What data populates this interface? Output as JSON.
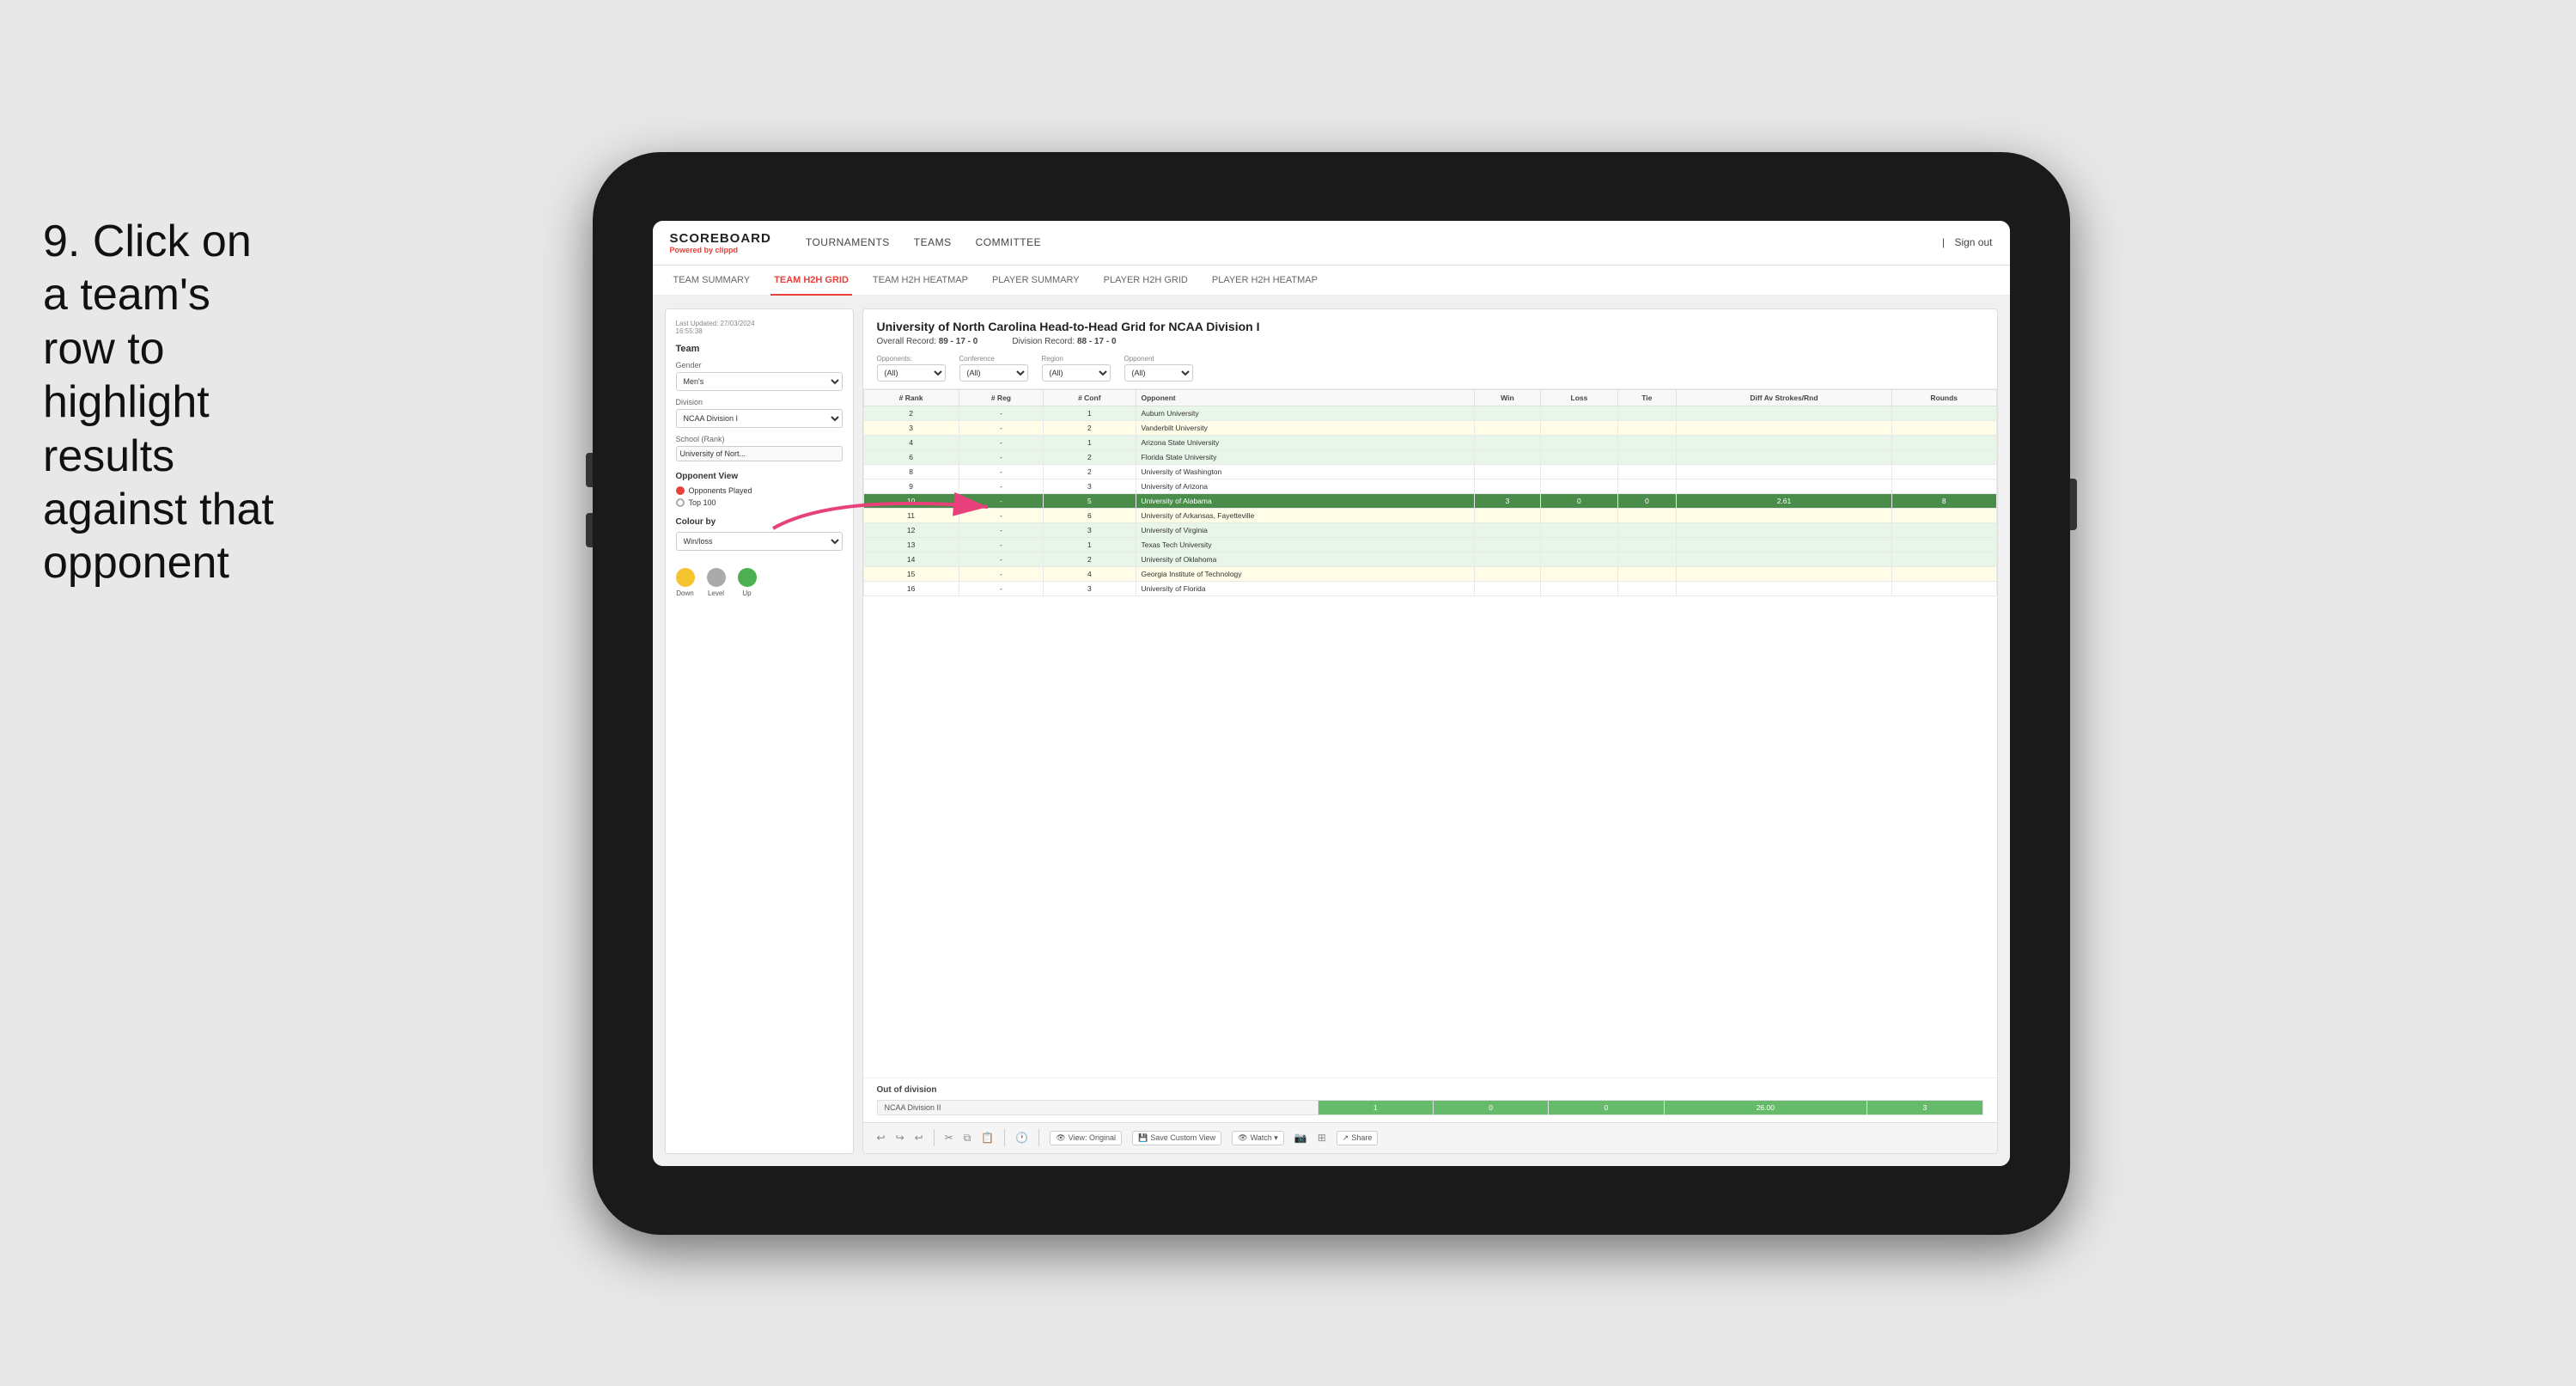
{
  "instruction": {
    "number": "9.",
    "text": "Click on a team's row to highlight results against that opponent"
  },
  "nav": {
    "logo_title": "SCOREBOARD",
    "logo_sub_prefix": "Powered by ",
    "logo_sub_brand": "clippd",
    "links": [
      "TOURNAMENTS",
      "TEAMS",
      "COMMITTEE"
    ],
    "sign_in": "Sign out"
  },
  "sub_nav": {
    "items": [
      "TEAM SUMMARY",
      "TEAM H2H GRID",
      "TEAM H2H HEATMAP",
      "PLAYER SUMMARY",
      "PLAYER H2H GRID",
      "PLAYER H2H HEATMAP"
    ],
    "active": "TEAM H2H GRID"
  },
  "left_panel": {
    "last_updated_label": "Last Updated: 27/03/2024",
    "last_updated_time": "16:55:38",
    "team_label": "Team",
    "gender_label": "Gender",
    "gender_value": "Men's",
    "division_label": "Division",
    "division_value": "NCAA Division I",
    "school_label": "School (Rank)",
    "school_value": "University of Nort...",
    "opponent_view_label": "Opponent View",
    "radio_options": [
      "Opponents Played",
      "Top 100"
    ],
    "radio_selected": "Opponents Played",
    "colour_by_label": "Colour by",
    "colour_by_value": "Win/loss",
    "legend": [
      {
        "label": "Down",
        "color": "#f4c430"
      },
      {
        "label": "Level",
        "color": "#aaa"
      },
      {
        "label": "Up",
        "color": "#4caf50"
      }
    ]
  },
  "grid": {
    "title": "University of North Carolina Head-to-Head Grid for NCAA Division I",
    "overall_record_label": "Overall Record:",
    "overall_record": "89 - 17 - 0",
    "division_record_label": "Division Record:",
    "division_record": "88 - 17 - 0",
    "filters": {
      "opponents_label": "Opponents:",
      "opponents_value": "(All)",
      "conference_label": "Conference",
      "conference_value": "(All)",
      "region_label": "Region",
      "region_value": "(All)",
      "opponent_label": "Opponent",
      "opponent_value": "(All)"
    },
    "columns": [
      "# Rank",
      "# Reg",
      "# Conf",
      "Opponent",
      "Win",
      "Loss",
      "Tie",
      "Diff Av Strokes/Rnd",
      "Rounds"
    ],
    "rows": [
      {
        "rank": "2",
        "reg": "-",
        "conf": "1",
        "opponent": "Auburn University",
        "win": "",
        "loss": "",
        "tie": "",
        "diff": "",
        "rounds": "",
        "style": "light-green"
      },
      {
        "rank": "3",
        "reg": "-",
        "conf": "2",
        "opponent": "Vanderbilt University",
        "win": "",
        "loss": "",
        "tie": "",
        "diff": "",
        "rounds": "",
        "style": "light-yellow"
      },
      {
        "rank": "4",
        "reg": "-",
        "conf": "1",
        "opponent": "Arizona State University",
        "win": "",
        "loss": "",
        "tie": "",
        "diff": "",
        "rounds": "",
        "style": "light-green"
      },
      {
        "rank": "6",
        "reg": "-",
        "conf": "2",
        "opponent": "Florida State University",
        "win": "",
        "loss": "",
        "tie": "",
        "diff": "",
        "rounds": "",
        "style": "light-green"
      },
      {
        "rank": "8",
        "reg": "-",
        "conf": "2",
        "opponent": "University of Washington",
        "win": "",
        "loss": "",
        "tie": "",
        "diff": "",
        "rounds": "",
        "style": "normal"
      },
      {
        "rank": "9",
        "reg": "-",
        "conf": "3",
        "opponent": "University of Arizona",
        "win": "",
        "loss": "",
        "tie": "",
        "diff": "",
        "rounds": "",
        "style": "normal"
      },
      {
        "rank": "10",
        "reg": "-",
        "conf": "5",
        "opponent": "University of Alabama",
        "win": "3",
        "loss": "0",
        "tie": "0",
        "diff": "2.61",
        "rounds": "8",
        "style": "highlighted"
      },
      {
        "rank": "11",
        "reg": "-",
        "conf": "6",
        "opponent": "University of Arkansas, Fayetteville",
        "win": "",
        "loss": "",
        "tie": "",
        "diff": "",
        "rounds": "",
        "style": "light-yellow"
      },
      {
        "rank": "12",
        "reg": "-",
        "conf": "3",
        "opponent": "University of Virginia",
        "win": "",
        "loss": "",
        "tie": "",
        "diff": "",
        "rounds": "",
        "style": "light-green"
      },
      {
        "rank": "13",
        "reg": "-",
        "conf": "1",
        "opponent": "Texas Tech University",
        "win": "",
        "loss": "",
        "tie": "",
        "diff": "",
        "rounds": "",
        "style": "light-green"
      },
      {
        "rank": "14",
        "reg": "-",
        "conf": "2",
        "opponent": "University of Oklahoma",
        "win": "",
        "loss": "",
        "tie": "",
        "diff": "",
        "rounds": "",
        "style": "light-green"
      },
      {
        "rank": "15",
        "reg": "-",
        "conf": "4",
        "opponent": "Georgia Institute of Technology",
        "win": "",
        "loss": "",
        "tie": "",
        "diff": "",
        "rounds": "",
        "style": "light-yellow"
      },
      {
        "rank": "16",
        "reg": "-",
        "conf": "3",
        "opponent": "University of Florida",
        "win": "",
        "loss": "",
        "tie": "",
        "diff": "",
        "rounds": "",
        "style": "normal"
      }
    ],
    "out_of_division": {
      "title": "Out of division",
      "rows": [
        {
          "name": "NCAA Division II",
          "win": "1",
          "loss": "0",
          "tie": "0",
          "diff": "26.00",
          "rounds": "3"
        }
      ]
    }
  },
  "toolbar": {
    "buttons": [
      "View: Original",
      "Save Custom View",
      "Watch ▾",
      "Share"
    ]
  }
}
